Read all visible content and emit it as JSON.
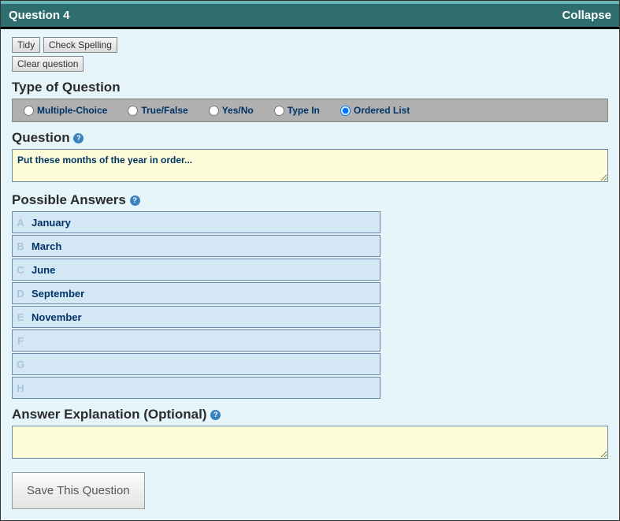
{
  "header": {
    "title": "Question 4",
    "collapse": "Collapse"
  },
  "buttons": {
    "tidy": "Tidy",
    "spell": "Check Spelling",
    "clear": "Clear question",
    "save": "Save This Question"
  },
  "labels": {
    "type_of_question": "Type of Question",
    "question": "Question",
    "possible_answers": "Possible Answers",
    "answer_explanation": "Answer Explanation (Optional)"
  },
  "types": [
    {
      "label": "Multiple-Choice",
      "checked": false
    },
    {
      "label": "True/False",
      "checked": false
    },
    {
      "label": "Yes/No",
      "checked": false
    },
    {
      "label": "Type In",
      "checked": false
    },
    {
      "label": "Ordered List",
      "checked": true
    }
  ],
  "question_text": "Put these months of the year in order...",
  "answers": [
    {
      "letter": "A",
      "value": "January"
    },
    {
      "letter": "B",
      "value": "March"
    },
    {
      "letter": "C",
      "value": "June"
    },
    {
      "letter": "D",
      "value": "September"
    },
    {
      "letter": "E",
      "value": "November"
    },
    {
      "letter": "F",
      "value": ""
    },
    {
      "letter": "G",
      "value": ""
    },
    {
      "letter": "H",
      "value": ""
    }
  ],
  "explanation_text": "",
  "help_glyph": "?"
}
